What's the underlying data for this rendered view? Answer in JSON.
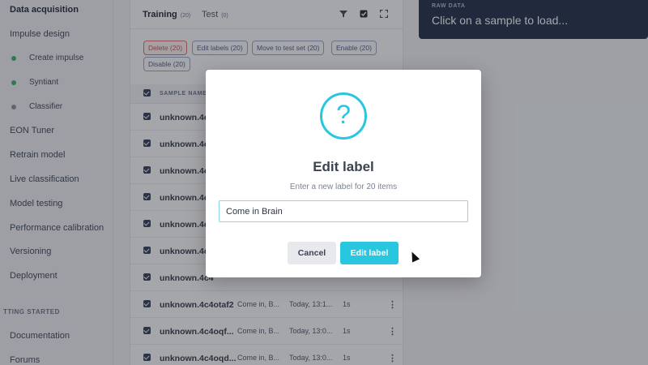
{
  "sidebar": {
    "items": [
      {
        "label": "Data acquisition"
      },
      {
        "label": "Impulse design"
      },
      {
        "label": "Create impulse",
        "dot": "#3fae6b"
      },
      {
        "label": "Syntiant",
        "dot": "#3fae6b"
      },
      {
        "label": "Classifier",
        "dot": "#8a8f99"
      },
      {
        "label": "EON Tuner"
      },
      {
        "label": "Retrain model"
      },
      {
        "label": "Live classification"
      },
      {
        "label": "Model testing"
      },
      {
        "label": "Performance calibration"
      },
      {
        "label": "Versioning"
      },
      {
        "label": "Deployment"
      }
    ],
    "section": "TTING STARTED",
    "bottom_items": [
      {
        "label": "Documentation"
      },
      {
        "label": "Forums"
      }
    ]
  },
  "tabs": {
    "training": {
      "label": "Training",
      "count": "(20)"
    },
    "test": {
      "label": "Test",
      "count": "(0)"
    }
  },
  "toolbar": {
    "filter_icon": "filter-icon",
    "select_icon": "checkbox-icon",
    "expand_icon": "expand-icon"
  },
  "actions": {
    "delete": "Delete (20)",
    "edit_labels": "Edit labels (20)",
    "move": "Move to test set (20)",
    "enable": "Enable (20)",
    "disable": "Disable (20)"
  },
  "table": {
    "header_name": "SAMPLE NAME",
    "rows": [
      {
        "name": "unknown.4c4"
      },
      {
        "name": "unknown.4c4"
      },
      {
        "name": "unknown.4c4"
      },
      {
        "name": "unknown.4c4"
      },
      {
        "name": "unknown.4c4"
      },
      {
        "name": "unknown.4c4"
      },
      {
        "name": "unknown.4c4"
      },
      {
        "name": "unknown.4c4otaf2",
        "label": "Come in, B...",
        "added": "Today, 13:1...",
        "length": "1s"
      },
      {
        "name": "unknown.4c4oqf...",
        "label": "Come in, B...",
        "added": "Today, 13:0...",
        "length": "1s"
      },
      {
        "name": "unknown.4c4oqd...",
        "label": "Come in, B...",
        "added": "Today, 13:0...",
        "length": "1s"
      }
    ]
  },
  "raw_data": {
    "label": "RAW DATA",
    "text": "Click on a sample to load..."
  },
  "modal": {
    "icon": "question-icon",
    "icon_glyph": "?",
    "title": "Edit label",
    "subtitle": "Enter a new label for 20 items",
    "input_value": "Come in Brain",
    "cancel_label": "Cancel",
    "confirm_label": "Edit label"
  },
  "colors": {
    "accent": "#29c6e0",
    "danger": "#d24c4c",
    "raw_bg": "#1d2a44"
  }
}
